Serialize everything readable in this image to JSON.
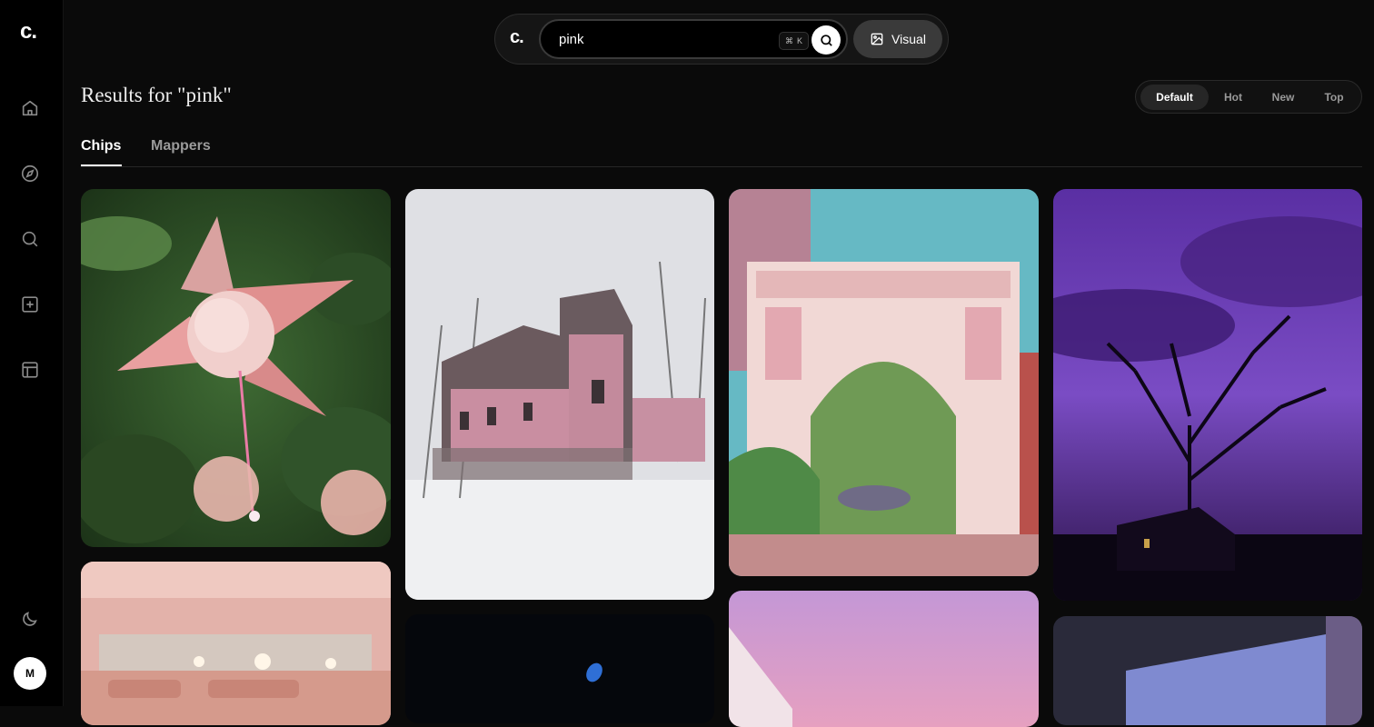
{
  "sidebar": {
    "logo": "c.",
    "items": [
      {
        "name": "home",
        "icon": "home-icon"
      },
      {
        "name": "explore",
        "icon": "compass-icon"
      },
      {
        "name": "search",
        "icon": "search-icon"
      },
      {
        "name": "create",
        "icon": "plus-square-icon"
      },
      {
        "name": "layout",
        "icon": "layout-icon"
      }
    ],
    "theme_icon": "moon-icon",
    "avatar_initial": "M"
  },
  "topbar": {
    "logo": "c.",
    "search_value": "pink",
    "shortcut_symbol": "⌘",
    "shortcut_key": "K",
    "visual_label": "Visual"
  },
  "results": {
    "title": "Results for \"pink\""
  },
  "sort": {
    "options": [
      "Default",
      "Hot",
      "New",
      "Top"
    ],
    "selected": "Default"
  },
  "tabs": {
    "chips": "Chips",
    "mappers": "Mappers",
    "active": "Chips"
  },
  "grid": {
    "cards": [
      {
        "subject": "pink fuchsia flower"
      },
      {
        "subject": "pink victorian house in snow"
      },
      {
        "subject": "painted arch in pink and teal"
      },
      {
        "subject": "purple sky with bare tree silhouette"
      },
      {
        "subject": "pink restaurant interior"
      },
      {
        "subject": "dark with blue object"
      },
      {
        "subject": "pink sunset sky over building"
      },
      {
        "subject": "blue window view"
      }
    ]
  },
  "colors": {
    "background": "#0a0a0a",
    "sidebar": "#000000",
    "accent": "#ffffff"
  }
}
